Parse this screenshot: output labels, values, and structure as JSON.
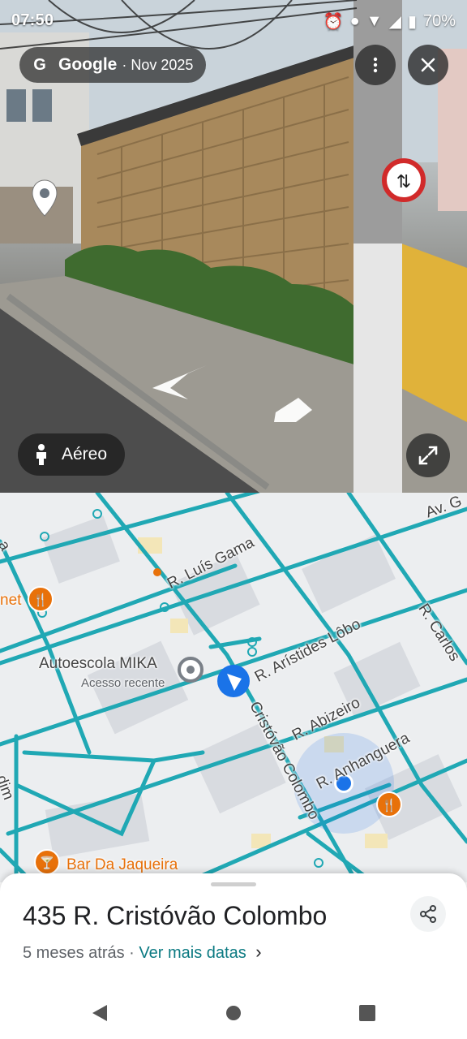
{
  "status_bar": {
    "time": "07:50",
    "battery": "70%"
  },
  "street_view": {
    "brand": "Google",
    "date": "· Nov 2025",
    "aereo_label": "Aéreo",
    "icons": [
      "google-g-icon",
      "more-vert-icon",
      "close-icon",
      "person-icon",
      "expand-icon",
      "place-marker-icon",
      "nav-arrow-icon"
    ]
  },
  "map": {
    "labels": {
      "av_g": "Av. G",
      "luis_gama": "R. Luís Gama",
      "aristides": "R. Arístides Lôbo",
      "carlos": "R. Carlos",
      "autoescola": "Autoescola MIKA",
      "acesso": "Acesso recente",
      "cristovao": "Cristóvão Colombo",
      "abizeiro": "R. Abizeiro",
      "anhanguera": "R. Anhanguera",
      "bar": "Bar Da Jaqueira",
      "net": "net",
      "a_left": "a",
      "dim": "dim"
    },
    "colors": {
      "road": "#20a8b4",
      "poi": "#e8710a",
      "location": "#1a73e8"
    }
  },
  "sheet": {
    "address": "435 R. Cristóvão Colombo",
    "when": "5 meses atrás",
    "separator": "·",
    "more_dates": "Ver mais datas",
    "chevron": "›"
  }
}
